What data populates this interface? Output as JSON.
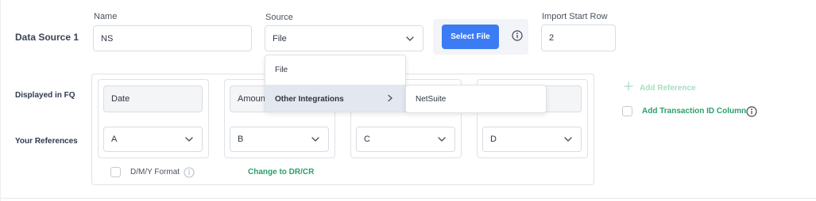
{
  "data_source": {
    "title": "Data Source 1"
  },
  "name_field": {
    "label": "Name",
    "value": "NS"
  },
  "source_field": {
    "label": "Source",
    "value": "File"
  },
  "select_file_button": {
    "label": "Select File"
  },
  "import_start_row": {
    "label": "Import Start Row",
    "value": "2"
  },
  "rows": {
    "displayed_label": "Displayed in FQ",
    "references_label": "Your References"
  },
  "columns": [
    {
      "displayed": "Date",
      "reference": "A"
    },
    {
      "displayed": "Amount",
      "reference": "B"
    },
    {
      "displayed": "",
      "reference": "C"
    },
    {
      "displayed": "",
      "reference": "D"
    }
  ],
  "date_format": {
    "label": "D/M/Y Format"
  },
  "change_link": {
    "label": "Change to DR/CR"
  },
  "add_reference": {
    "label": "Add Reference"
  },
  "add_transaction": {
    "label": "Add Transaction ID Column"
  },
  "source_dropdown": {
    "options": [
      "File",
      "Other Integrations"
    ],
    "submenu": [
      "NetSuite"
    ]
  },
  "colors": {
    "accent": "#3b7cf4",
    "link_green": "#2aa06a",
    "disabled_green": "#a8dcc2"
  }
}
